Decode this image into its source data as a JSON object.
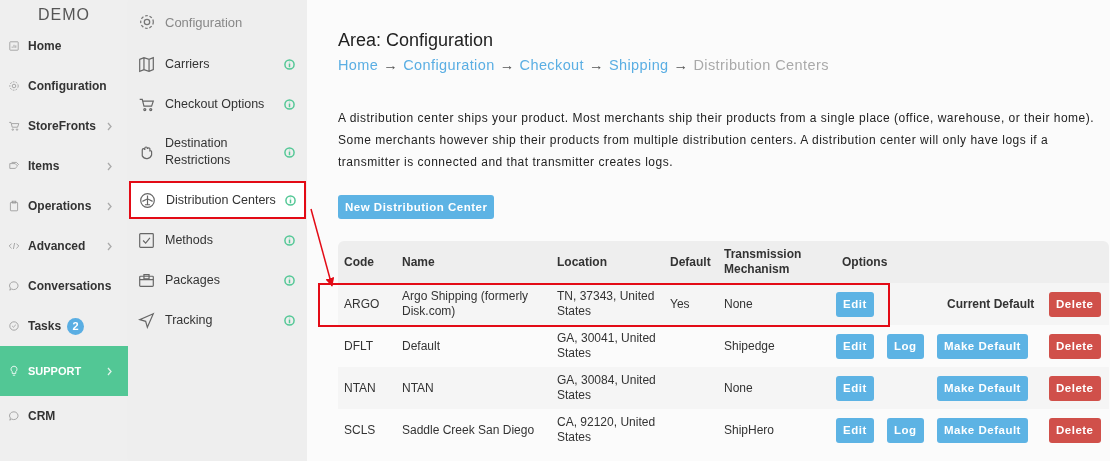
{
  "brand": "DEMO",
  "sidebar": {
    "items": [
      {
        "label": "Home",
        "chevron": false,
        "selected": false
      },
      {
        "label": "Configuration",
        "chevron": false,
        "selected": false
      },
      {
        "label": "StoreFronts",
        "chevron": true,
        "selected": false
      },
      {
        "label": "Items",
        "chevron": true,
        "selected": false
      },
      {
        "label": "Operations",
        "chevron": true,
        "selected": false
      },
      {
        "label": "Advanced",
        "chevron": true,
        "selected": false
      },
      {
        "label": "Conversations",
        "chevron": false,
        "selected": false
      },
      {
        "label": "Tasks",
        "chevron": false,
        "selected": false,
        "badge": "2"
      },
      {
        "label": "SUPPORT",
        "chevron": true,
        "selected": true
      },
      {
        "label": "CRM",
        "chevron": false,
        "selected": false
      }
    ]
  },
  "submenu": {
    "title": "Configuration",
    "items": [
      {
        "label": "Carriers",
        "highlighted": false
      },
      {
        "label": "Checkout Options",
        "highlighted": false
      },
      {
        "label": "Destination Restrictions",
        "highlighted": false
      },
      {
        "label": "Distribution Centers",
        "highlighted": true
      },
      {
        "label": "Methods",
        "highlighted": false
      },
      {
        "label": "Packages",
        "highlighted": false
      },
      {
        "label": "Tracking",
        "highlighted": false
      }
    ]
  },
  "page": {
    "title": "Area: Configuration",
    "breadcrumb": [
      {
        "label": "Home",
        "current": false
      },
      {
        "label": "Configuration",
        "current": false
      },
      {
        "label": "Checkout",
        "current": false
      },
      {
        "label": "Shipping",
        "current": false
      },
      {
        "label": "Distribution Centers",
        "current": true
      }
    ],
    "separator": "→",
    "description": "A distribution center ships your product. Most merchants ship their products from a single place (office, warehouse, or their home). Some merchants however ship their products from multiple distribution centers. A distribution center will only have logs if a transmitter is connected and that transmitter creates logs.",
    "new_button": "New Distribution Center"
  },
  "table": {
    "columns": [
      "Code",
      "Name",
      "Location",
      "Default",
      "Transmission Mechanism",
      "Options"
    ],
    "rows": [
      {
        "code": "ARGO",
        "name": "Argo Shipping (formerly Disk.com)",
        "location": "TN, 37343, United States",
        "default": "Yes",
        "transmission": "None",
        "edit": "Edit",
        "default_action": {
          "kind": "text",
          "label": "Current Default"
        },
        "delete": "Delete",
        "highlighted": true
      },
      {
        "code": "DFLT",
        "name": "Default",
        "location": "GA, 30041, United States",
        "transmission": "Shipedge",
        "edit": "Edit",
        "log": "Log",
        "default_action": {
          "kind": "button",
          "label": "Make Default"
        },
        "delete": "Delete",
        "highlighted": false
      },
      {
        "code": "NTAN",
        "name": "NTAN",
        "location": "GA, 30084, United States",
        "transmission": "None",
        "edit": "Edit",
        "default_action": {
          "kind": "button",
          "label": "Make Default"
        },
        "delete": "Delete",
        "highlighted": false
      },
      {
        "code": "SCLS",
        "name": "Saddle Creek San Diego",
        "location": "CA, 92120, United States",
        "transmission": "ShipHero",
        "edit": "Edit",
        "log": "Log",
        "default_action": {
          "kind": "button",
          "label": "Make Default"
        },
        "delete": "Delete",
        "highlighted": false
      }
    ]
  }
}
